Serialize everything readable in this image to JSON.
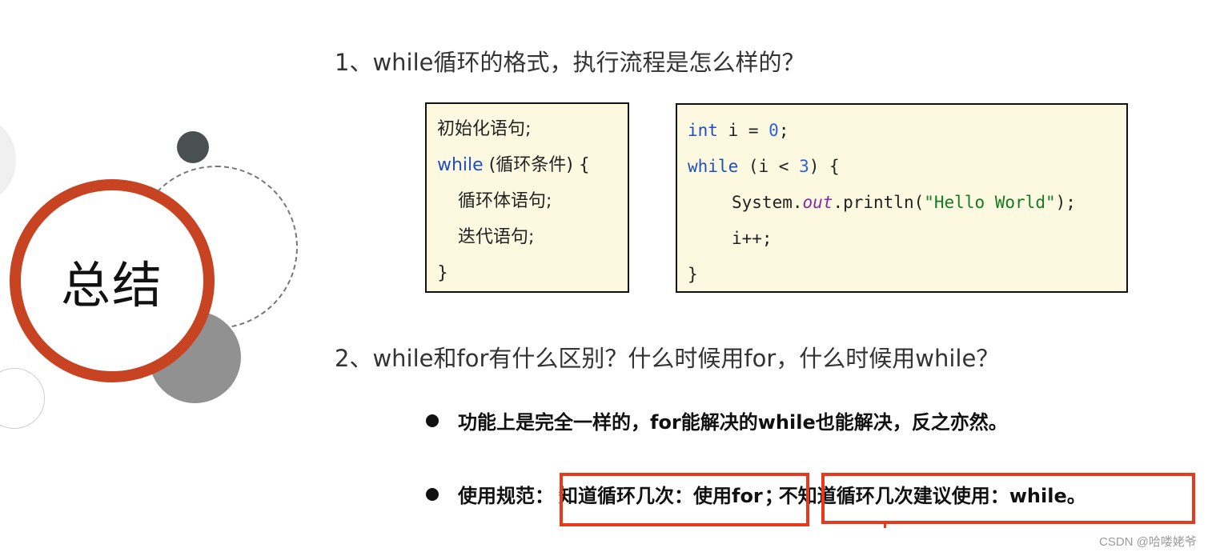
{
  "sidebar": {
    "title": "总结"
  },
  "question1": {
    "heading": "1、while循环的格式，执行流程是怎么样的？",
    "syntax_lines": [
      {
        "text": "初始化语句;"
      },
      {
        "keyword": "while",
        "rest": " (循环条件) {"
      },
      {
        "text": "循环体语句;"
      },
      {
        "text": "迭代语句;"
      },
      {
        "text": "}"
      }
    ],
    "example": {
      "line1": {
        "kw": "int",
        "mid": " i = ",
        "num": "0",
        "end": ";"
      },
      "line2": {
        "kw": "while",
        "mid": " (i < ",
        "num": "3",
        "end": ") {"
      },
      "line3": {
        "pre": "System.",
        "field": "out",
        "mid": ".println(",
        "str": "\"Hello World\"",
        "end": ");"
      },
      "line4": "i++;",
      "line5": "}"
    }
  },
  "question2": {
    "heading": "2、while和for有什么区别？什么时候用for，什么时候用while？",
    "bullets": [
      {
        "text": "功能上是完全一样的，for能解决的while也能解决，反之亦然。"
      },
      {
        "prefix": "使用规范：",
        "part1": "知道循环几次：使用for",
        "sep": "；",
        "part2": "不知道循环几次建议使用：while。"
      }
    ]
  },
  "colors": {
    "accent_red": "#c84322",
    "highlight_red": "#e8391d",
    "code_bg": "#fdf9e1",
    "keyword_blue": "#1f4fbf",
    "string_green": "#157a24",
    "field_purple": "#8a2aa0"
  },
  "watermark": "CSDN @哈喽姥爷"
}
